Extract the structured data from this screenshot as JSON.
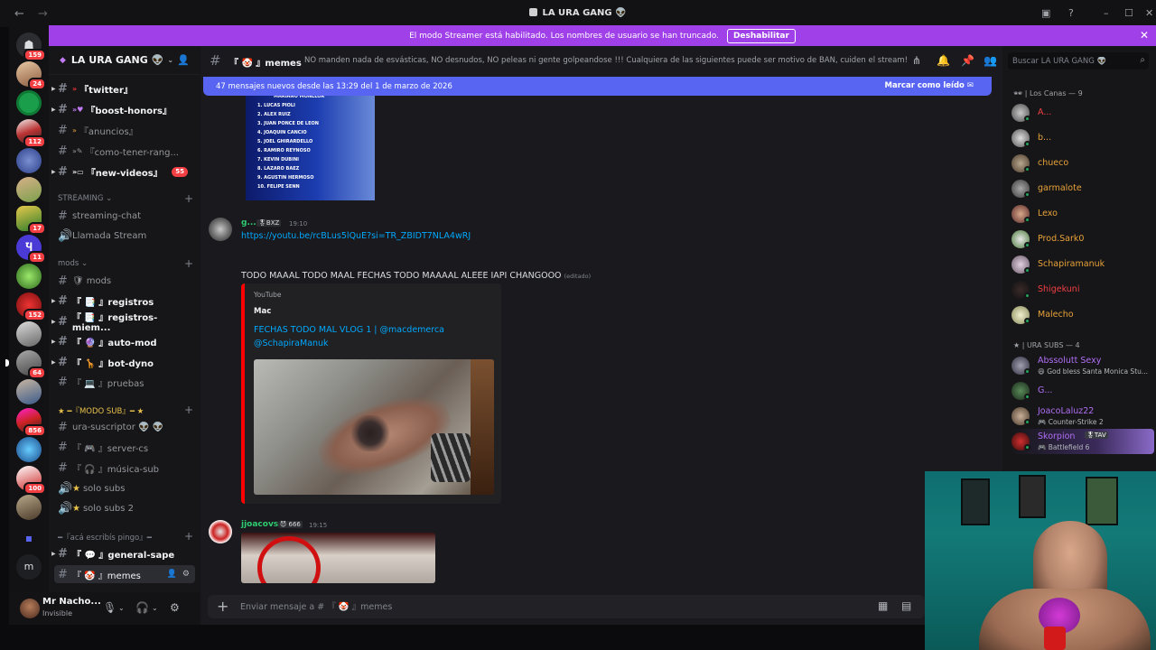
{
  "window": {
    "title": "LA URA GANG 👽"
  },
  "banner": {
    "text": "El modo Streamer está habilitado. Los nombres de usuario se han truncado.",
    "button": "Deshabilitar"
  },
  "rail": {
    "badges": [
      "159",
      "24",
      "112",
      "17",
      "11",
      "152",
      "64",
      "856",
      "100"
    ],
    "letter": "m"
  },
  "server": {
    "name": "LA URA GANG 👽"
  },
  "channels": {
    "twitter": "『twitter』",
    "boost": "『boost-honors』",
    "anuncios": "『anuncios』",
    "como": "『como-tener-rang...",
    "newvideos": "『new-videos』",
    "newvideos_badge": "55",
    "cat_streaming": "STREAMING",
    "streaming_chat": "streaming-chat",
    "llamada": "Llamada Stream",
    "cat_mods": "mods",
    "mods": "mods",
    "registros": "『 📑 』registros",
    "registros_miem": "『 📑 』registros-miem...",
    "automod": "『 🔮 』auto-mod",
    "botdyno": "『 🦒 』bot-dyno",
    "pruebas": "『 💻 』pruebas",
    "cat_modosub": "★ ━『MODO SUB』━ ★",
    "urasuscriptor": "ura-suscriptor 👽 👽",
    "servercs": "『 🎮 』server-cs",
    "musicasub": "『 🎧 』música-sub",
    "solosubs": "solo subs",
    "solosubs2": "solo subs 2",
    "cat_aca": "━『acá escribís pingo』━",
    "generalsape": "『 💬 』general-sape",
    "memes": "『 🤡 』memes"
  },
  "user": {
    "name": "Mr Nacho...",
    "status": "Invisible"
  },
  "header": {
    "channel": "『 🤡 』memes",
    "topic": "NO manden nada de esvásticas, NO desnudos, NO peleas ni gente golpeandose !!! Cualquiera de las siguientes puede ser motivo de BAN, cuiden el stream!"
  },
  "newbar": {
    "text": "47 mensajes nuevos desde las 13:29 del 1 de marzo de 2026",
    "action": "Marcar como leído"
  },
  "lineup": [
    "MARIANO MONLLOR",
    "LUCAS PIOLI",
    "ALEX RUIZ",
    "JUAN PONCE DE LEON",
    "JOAQUIN CANCIO",
    "JOEL GHIRARDELLO",
    "RAMIRO REYNOSO",
    "KEVIN DUBINI",
    "LAZARO BAEZ",
    "AGUSTIN HERMOSO",
    "FELIPE SENN"
  ],
  "messages": [
    {
      "author": "g...",
      "tag": "🎖BXZ",
      "time": "19:10",
      "link": "https://youtu.be/rcBLus5lQuE?si=TR_ZBIDT7NLA4wRJ",
      "text": "TODO MAAAL TODO MAAL FECHAS TODO MAAAAL ALEEE IAPI CHANGOOO",
      "edited": "(editado)",
      "embed": {
        "provider": "YouTube",
        "author": "Mac",
        "title": "FECHAS TODO MAL VLOG 1 | @macdemerca @SchapiraManuk"
      }
    },
    {
      "author": "jjoacovs",
      "tag": "😈 666",
      "time": "19:15"
    }
  ],
  "composer": {
    "placeholder": "Enviar mensaje a # 『 🤡 』memes"
  },
  "members": {
    "search_placeholder": "Buscar LA URA GANG 👽",
    "group1": "🕶 | Los Canas — 9",
    "list1": [
      {
        "name": "A...",
        "color": "#f23f43"
      },
      {
        "name": "b...",
        "color": "#e8a23a"
      },
      {
        "name": "chueco",
        "color": "#e8a23a"
      },
      {
        "name": "garmalote",
        "color": "#e8a23a"
      },
      {
        "name": "Lexo",
        "color": "#e8a23a"
      },
      {
        "name": "Prod.Sark0",
        "color": "#e8a23a"
      },
      {
        "name": "Schapiramanuk",
        "color": "#e8a23a"
      },
      {
        "name": "Shigekuni",
        "color": "#f23f43"
      },
      {
        "name": "Malecho",
        "color": "#e8a23a"
      }
    ],
    "group2": "★ | URA SUBS — 4",
    "list2": [
      {
        "name": "Abssolutt Sexy",
        "sub": "😄 God bless Santa Monica Stu...",
        "color": "#b06ef5"
      },
      {
        "name": "G...",
        "sub": "",
        "color": "#b06ef5"
      },
      {
        "name": "JoacoLaluz22",
        "sub": "🎮 Counter-Strike 2",
        "color": "#b06ef5"
      },
      {
        "name": "Skorpion",
        "tag": "🎖TAV",
        "sub": "🎮 Battlefield 6",
        "color": "#b06ef5"
      }
    ]
  },
  "colors": {
    "accent": "#5865f2",
    "banner": "#a040e8",
    "embed_bar": "#ff0000",
    "link": "#00a8fc"
  }
}
